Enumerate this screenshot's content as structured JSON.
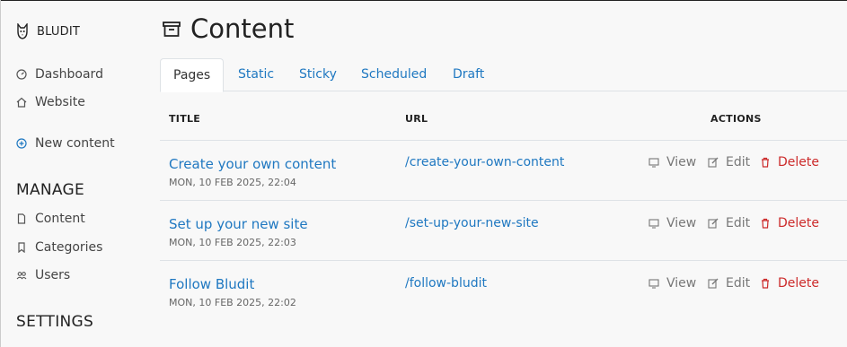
{
  "app": {
    "brand": "BLUDIT"
  },
  "sidebar": {
    "items": [
      {
        "label": "Dashboard",
        "icon": "dashboard-icon"
      },
      {
        "label": "Website",
        "icon": "home-icon"
      },
      {
        "label": "New content",
        "icon": "plus-circle-icon"
      }
    ],
    "manage": {
      "title": "MANAGE",
      "items": [
        {
          "label": "Content",
          "icon": "file-icon"
        },
        {
          "label": "Categories",
          "icon": "bookmark-icon"
        },
        {
          "label": "Users",
          "icon": "users-icon"
        }
      ]
    },
    "settings": {
      "title": "SETTINGS"
    }
  },
  "main": {
    "title": "Content",
    "tabs": [
      {
        "label": "Pages",
        "active": true
      },
      {
        "label": "Static",
        "active": false
      },
      {
        "label": "Sticky",
        "active": false
      },
      {
        "label": "Scheduled",
        "active": false
      },
      {
        "label": "Draft",
        "active": false
      }
    ],
    "table": {
      "headers": {
        "title": "TITLE",
        "url": "URL",
        "actions": "ACTIONS"
      },
      "rows": [
        {
          "title": "Create your own content",
          "date": "MON, 10 FEB 2025, 22:04",
          "url": "/create-your-own-content"
        },
        {
          "title": "Set up your new site",
          "date": "MON, 10 FEB 2025, 22:03",
          "url": "/set-up-your-new-site"
        },
        {
          "title": "Follow Bludit",
          "date": "MON, 10 FEB 2025, 22:02",
          "url": "/follow-bludit"
        }
      ],
      "actions": {
        "view": "View",
        "edit": "Edit",
        "delete": "Delete"
      }
    }
  },
  "colors": {
    "link": "#1f78c1",
    "danger": "#cc2a2a",
    "muted": "#777777"
  }
}
